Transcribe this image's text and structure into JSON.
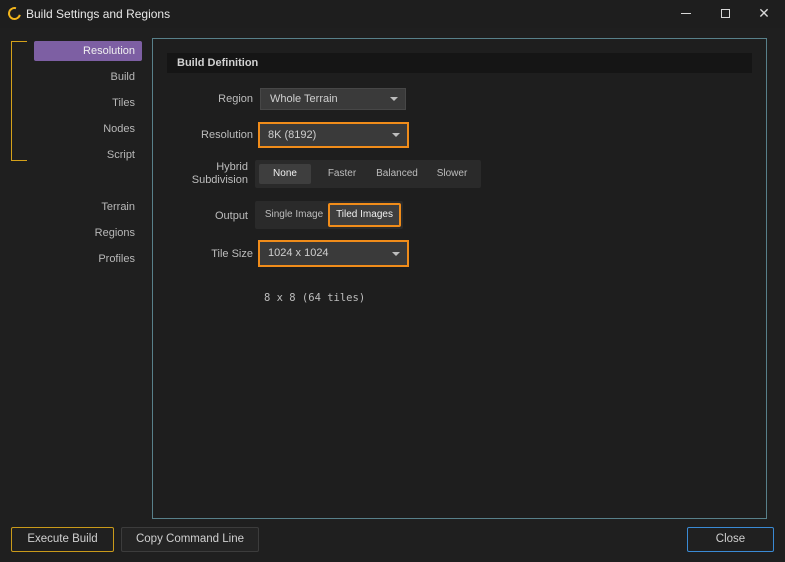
{
  "window": {
    "title": "Build Settings and Regions"
  },
  "sidebar": {
    "items": [
      {
        "label": "Resolution"
      },
      {
        "label": "Build"
      },
      {
        "label": "Tiles"
      },
      {
        "label": "Nodes"
      },
      {
        "label": "Script"
      },
      {
        "label": "Terrain"
      },
      {
        "label": "Regions"
      },
      {
        "label": "Profiles"
      }
    ]
  },
  "main": {
    "section_title": "Build Definition",
    "region": {
      "label": "Region",
      "value": "Whole Terrain"
    },
    "resolution": {
      "label": "Resolution",
      "value": "8K (8192)"
    },
    "hybrid": {
      "label_line1": "Hybrid",
      "label_line2": "Subdivision",
      "options": [
        "None",
        "Faster",
        "Balanced",
        "Slower"
      ],
      "selected": "None"
    },
    "output": {
      "label": "Output",
      "options": [
        "Single Image",
        "Tiled Images"
      ],
      "selected": "Tiled Images"
    },
    "tile_size": {
      "label": "Tile Size",
      "value": "1024 x 1024"
    },
    "tile_info": "8 x 8 (64 tiles)"
  },
  "footer": {
    "execute_label": "Execute Build",
    "copy_label": "Copy Command Line",
    "close_label": "Close"
  },
  "colors": {
    "accent_purple": "#7d5fa3",
    "highlight_orange": "#f08c1a",
    "bracket_gold": "#d4a11a",
    "close_blue": "#3a8ad4"
  }
}
